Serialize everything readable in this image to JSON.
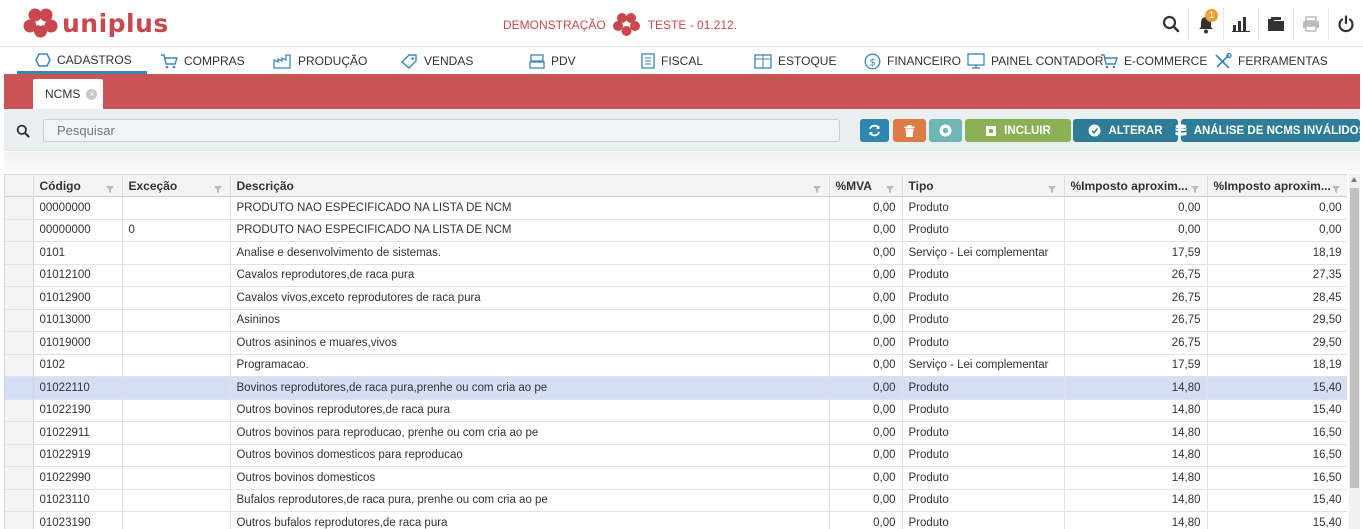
{
  "app": {
    "logo_text": "uniplus",
    "company_prefix": "DEMONSTRAÇÃO",
    "company_name": "TESTE - 01.212."
  },
  "header_icons": [
    {
      "name": "search-icon"
    },
    {
      "name": "bell-icon",
      "badge": "1"
    },
    {
      "name": "chart-icon"
    },
    {
      "name": "folder-icon"
    },
    {
      "name": "printer-icon"
    },
    {
      "name": "power-icon"
    }
  ],
  "menu": [
    {
      "label": "CADASTROS",
      "icon": "hexagon-icon",
      "active": true
    },
    {
      "label": "COMPRAS",
      "icon": "cart-icon"
    },
    {
      "label": "PRODUÇÃO",
      "icon": "factory-icon"
    },
    {
      "label": "VENDAS",
      "icon": "tag-icon"
    },
    {
      "label": "PDV",
      "icon": "pos-icon"
    },
    {
      "label": "FISCAL",
      "icon": "document-icon"
    },
    {
      "label": "ESTOQUE",
      "icon": "box-icon"
    },
    {
      "label": "FINANCEIRO",
      "icon": "dollar-icon"
    },
    {
      "label": "PAINEL CONTADOR",
      "icon": "monitor-icon"
    },
    {
      "label": "E-COMMERCE",
      "icon": "cart-icon"
    },
    {
      "label": "FERRAMENTAS",
      "icon": "tools-icon"
    }
  ],
  "tab": {
    "label": "NCMS",
    "close": "×"
  },
  "search": {
    "placeholder": "Pesquisar"
  },
  "buttons": {
    "incluir": "INCLUIR",
    "alterar": "ALTERAR",
    "analise": "ANÁLISE DE NCMS INVÁLIDOS"
  },
  "colors": {
    "brand": "#c9474d",
    "tabbar": "#c85456",
    "refresh": "#2e87b0",
    "delete": "#e07a45",
    "view": "#6fb7b4",
    "incluir": "#8bb154",
    "alterar": "#2e7d96",
    "analise": "#2e7d96",
    "selected_row": "#d6def5"
  },
  "columns": [
    "Código",
    "Exceção",
    "Descrição",
    "%MVA",
    "Tipo",
    "%Imposto aproxim...",
    "%Imposto aproxim..."
  ],
  "rows": [
    [
      "00000000",
      "",
      "PRODUTO NAO ESPECIFICADO NA LISTA DE NCM",
      "0,00",
      "Produto",
      "0,00",
      "0,00"
    ],
    [
      "00000000",
      "0",
      "PRODUTO NAO ESPECIFICADO NA LISTA DE NCM",
      "0,00",
      "Produto",
      "0,00",
      "0,00"
    ],
    [
      "0101",
      "",
      "Analise e desenvolvimento de sistemas.",
      "0,00",
      "Serviço - Lei complementar",
      "17,59",
      "18,19"
    ],
    [
      "01012100",
      "",
      "Cavalos reprodutores,de raca pura",
      "0,00",
      "Produto",
      "26,75",
      "27,35"
    ],
    [
      "01012900",
      "",
      "Cavalos vivos,exceto reprodutores de raca pura",
      "0,00",
      "Produto",
      "26,75",
      "28,45"
    ],
    [
      "01013000",
      "",
      "Asininos",
      "0,00",
      "Produto",
      "26,75",
      "29,50"
    ],
    [
      "01019000",
      "",
      "Outros asininos e muares,vivos",
      "0,00",
      "Produto",
      "26,75",
      "29,50"
    ],
    [
      "0102",
      "",
      "Programacao.",
      "0,00",
      "Serviço - Lei complementar",
      "17,59",
      "18,19"
    ],
    [
      "01022110",
      "",
      "Bovinos reprodutores,de raca pura,prenhe ou com cria ao pe",
      "0,00",
      "Produto",
      "14,80",
      "15,40"
    ],
    [
      "01022190",
      "",
      "Outros bovinos reprodutores,de raca pura",
      "0,00",
      "Produto",
      "14,80",
      "15,40"
    ],
    [
      "01022911",
      "",
      "Outros bovinos para reproducao, prenhe ou com cria ao pe",
      "0,00",
      "Produto",
      "14,80",
      "16,50"
    ],
    [
      "01022919",
      "",
      "Outros bovinos domesticos para reproducao",
      "0,00",
      "Produto",
      "14,80",
      "16,50"
    ],
    [
      "01022990",
      "",
      "Outros bovinos domesticos",
      "0,00",
      "Produto",
      "14,80",
      "16,50"
    ],
    [
      "01023110",
      "",
      "Bufalos reprodutores,de raca pura, prenhe ou com cria ao pe",
      "0,00",
      "Produto",
      "14,80",
      "15,40"
    ],
    [
      "01023190",
      "",
      "Outros bufalos reprodutores,de raca pura",
      "0,00",
      "Produto",
      "14,80",
      "15,40"
    ]
  ],
  "selected_row_index": 8
}
